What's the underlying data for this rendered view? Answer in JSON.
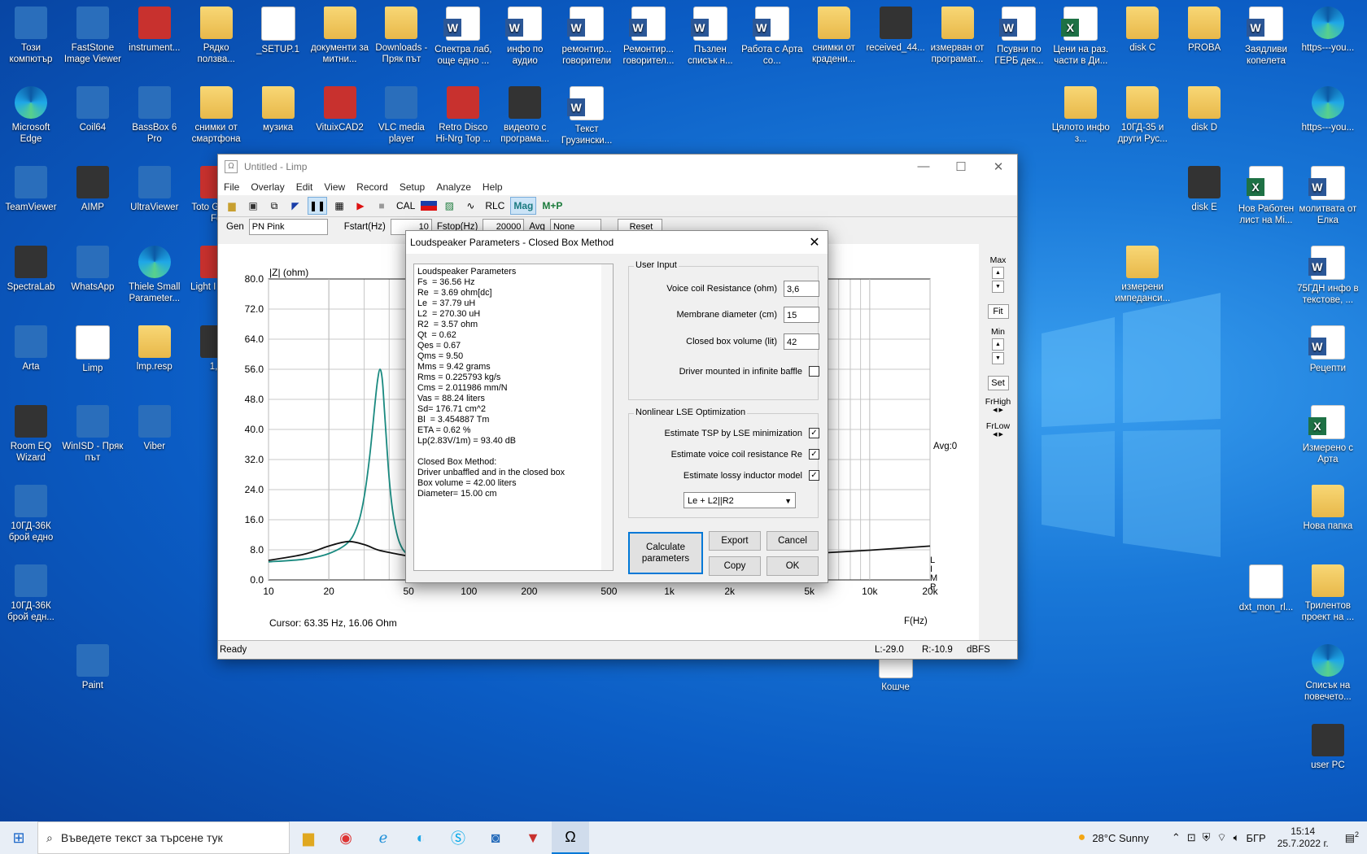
{
  "desktop": {
    "icons": [
      {
        "label": "Този компютър",
        "kind": "app"
      },
      {
        "label": "FastStone Image Viewer",
        "kind": "app"
      },
      {
        "label": "instrument...",
        "kind": "red"
      },
      {
        "label": "Рядко ползва...",
        "kind": "folder"
      },
      {
        "label": "_SETUP.1",
        "kind": "blank"
      },
      {
        "label": "документи за митни...",
        "kind": "folder"
      },
      {
        "label": "Downloads - Пряк път",
        "kind": "folder"
      },
      {
        "label": "Спектра лаб, още едно ...",
        "kind": "word"
      },
      {
        "label": "инфо по аудио",
        "kind": "word"
      },
      {
        "label": "ремонтир... говорители",
        "kind": "word"
      },
      {
        "label": "Ремонтир... говорител...",
        "kind": "word"
      },
      {
        "label": "Пъзлен списък н...",
        "kind": "word"
      },
      {
        "label": "Работа с Арта со...",
        "kind": "word"
      },
      {
        "label": "снимки от крадени...",
        "kind": "folder"
      },
      {
        "label": "received_44...",
        "kind": "dark"
      },
      {
        "label": "измерван от програмат...",
        "kind": "folder"
      },
      {
        "label": "Псувни по ГЕРБ дек...",
        "kind": "word"
      },
      {
        "label": "Цени на раз. части в Ди...",
        "kind": "excel"
      },
      {
        "label": "disk C",
        "kind": "folder"
      },
      {
        "label": "PROBA",
        "kind": "folder"
      },
      {
        "label": "Заядливи копелета",
        "kind": "word"
      },
      {
        "label": "https---you...",
        "kind": "edge"
      },
      {
        "label": "Microsoft Edge",
        "kind": "edge"
      },
      {
        "label": "Coil64",
        "kind": "app"
      },
      {
        "label": "BassBox 6 Pro",
        "kind": "app"
      },
      {
        "label": "снимки от смартфона",
        "kind": "folder"
      },
      {
        "label": "музика",
        "kind": "folder"
      },
      {
        "label": "VituixCAD2",
        "kind": "red"
      },
      {
        "label": "VLC media player",
        "kind": "app"
      },
      {
        "label": "Retro Disco Hi-Nrg Top ...",
        "kind": "red"
      },
      {
        "label": "видеото с програма...",
        "kind": "dark"
      },
      {
        "label": "Текст Грузински...",
        "kind": "word"
      },
      {
        "label": "Цялото инфо з...",
        "kind": "folder"
      },
      {
        "label": "10ГД-35 и други Рус...",
        "kind": "folder"
      },
      {
        "label": "disk D",
        "kind": "folder"
      },
      {
        "label": "https---you...",
        "kind": "edge"
      },
      {
        "label": "TeamViewer",
        "kind": "app"
      },
      {
        "label": "AIMP",
        "kind": "dark"
      },
      {
        "label": "UltraViewer",
        "kind": "app"
      },
      {
        "label": "Toto Gr Hits Fo",
        "kind": "red"
      },
      {
        "label": "disk E",
        "kind": "dark"
      },
      {
        "label": "Нов Работен лист на Mi...",
        "kind": "excel"
      },
      {
        "label": "молитвата от Елка",
        "kind": "word"
      },
      {
        "label": "SpectraLab",
        "kind": "dark"
      },
      {
        "label": "WhatsApp",
        "kind": "app"
      },
      {
        "label": "Thiele Small Parameter...",
        "kind": "edge"
      },
      {
        "label": "Light I Resiz",
        "kind": "red"
      },
      {
        "label": "измерени импеданси...",
        "kind": "folder"
      },
      {
        "label": "75ГДН инфо в текстове, ...",
        "kind": "word"
      },
      {
        "label": "Arta",
        "kind": "app"
      },
      {
        "label": "Limp",
        "kind": "blank"
      },
      {
        "label": "lmp.resp",
        "kind": "folder"
      },
      {
        "label": "1,1",
        "kind": "dark"
      },
      {
        "label": "Рецепти",
        "kind": "word"
      },
      {
        "label": "Room EQ Wizard",
        "kind": "dark"
      },
      {
        "label": "WinISD - Пряк път",
        "kind": "app"
      },
      {
        "label": "Viber",
        "kind": "app"
      },
      {
        "label": "Измерено с Арта",
        "kind": "excel"
      },
      {
        "label": "Нова папка",
        "kind": "folder"
      },
      {
        "label": "10ГД-36К брой едно",
        "kind": "app"
      },
      {
        "label": "10ГД-36К брой едн...",
        "kind": "app"
      },
      {
        "label": "dxt_mon_rl...",
        "kind": "blank"
      },
      {
        "label": "Трилентов проект на ...",
        "kind": "folder"
      },
      {
        "label": "Paint",
        "kind": "app"
      },
      {
        "label": "Кошче",
        "kind": "blank"
      },
      {
        "label": "Списък на повечето...",
        "kind": "edge"
      },
      {
        "label": "user PC",
        "kind": "dark"
      }
    ]
  },
  "window": {
    "title": "Untitled - Limp",
    "app_icon": "Ω",
    "controls": {
      "minimize": "—",
      "maximize": "☐",
      "close": "✕"
    },
    "menu": [
      "File",
      "Overlay",
      "Edit",
      "View",
      "Record",
      "Setup",
      "Analyze",
      "Help"
    ],
    "toolbar": {
      "cal": "CAL",
      "rlc": "RLC",
      "mag": "Mag",
      "mp": "M+P"
    },
    "genbar": {
      "gen_label": "Gen",
      "gen_value": "PN Pink",
      "fstart_label": "Fstart(Hz)",
      "fstart_value": "10",
      "fstop_label": "Fstop(Hz)",
      "fstop_value": "20000",
      "avg_label": "Avg",
      "avg_value": "None",
      "reset_label": "Reset"
    },
    "plot": {
      "ylabel": "|Z| (ohm)",
      "xlabel": "F(Hz)",
      "avg_text": "Avg:0",
      "cursor_text": "Cursor: 63.35 Hz, 16.06 Ohm",
      "watermark": [
        "L",
        "I",
        "M",
        "P"
      ]
    },
    "right_panel": {
      "max": "Max",
      "fit": "Fit",
      "min": "Min",
      "set": "Set",
      "frhigh": "FrHigh",
      "frlow": "FrLow"
    },
    "status": {
      "ready": "Ready",
      "l": "L:-29.0",
      "r": "R:-10.9",
      "unit": "dBFS"
    }
  },
  "chart_data": {
    "type": "line",
    "xlabel": "F(Hz)",
    "ylabel": "|Z| (ohm)",
    "xscale": "log",
    "xlim": [
      10,
      20000
    ],
    "ylim": [
      0,
      80
    ],
    "xticks": [
      10,
      20,
      50,
      100,
      200,
      500,
      1000,
      2000,
      5000,
      10000,
      20000
    ],
    "xtick_labels": [
      "10",
      "20",
      "50",
      "100",
      "200",
      "500",
      "1k",
      "2k",
      "5k",
      "10k",
      "20k"
    ],
    "yticks": [
      0,
      8,
      16,
      24,
      32,
      40,
      48,
      56,
      64,
      72,
      80
    ],
    "ytick_labels": [
      "0.0",
      "8.0",
      "16.0",
      "24.0",
      "32.0",
      "40.0",
      "48.0",
      "56.0",
      "64.0",
      "72.0",
      "80.0"
    ],
    "grid": true,
    "series": [
      {
        "color": "#1a8a80",
        "x": [
          10,
          15,
          20,
          25,
          28,
          30,
          32,
          34,
          35,
          36,
          37,
          38,
          40,
          42,
          45,
          50,
          60,
          80,
          100
        ],
        "y": [
          4.8,
          5.5,
          7.0,
          10,
          15,
          22,
          33,
          47,
          53,
          56,
          53,
          44,
          27,
          17,
          10,
          6.5,
          5.0,
          4.5,
          4.3
        ]
      },
      {
        "color": "#111111",
        "x": [
          10,
          15,
          20,
          25,
          30,
          35,
          40,
          50,
          60,
          80,
          100,
          150,
          200,
          300,
          500,
          1000,
          2000,
          5000,
          10000,
          20000
        ],
        "y": [
          5.2,
          6.8,
          9.0,
          10.2,
          9.4,
          8.0,
          7.3,
          6.3,
          5.5,
          5.0,
          4.9,
          4.8,
          4.8,
          4.9,
          5.1,
          5.4,
          6.0,
          7.0,
          7.9,
          9.0
        ]
      }
    ]
  },
  "dialog": {
    "title": "Loudspeaker Parameters - Closed Box Method",
    "close": "✕",
    "params": [
      "Loudspeaker Parameters",
      "Fs  = 36.56 Hz",
      "Re  = 3.69 ohm[dc]",
      "Le  = 37.79 uH",
      "L2  = 270.30 uH",
      "R2  = 3.57 ohm",
      "Qt  = 0.62",
      "Qes = 0.67",
      "Qms = 9.50",
      "Mms = 9.42 grams",
      "Rms = 0.225793 kg/s",
      "Cms = 2.011986 mm/N",
      "Vas = 88.24 liters",
      "Sd= 176.71 cm^2",
      "Bl  = 3.454887 Tm",
      "ETA = 0.62 %",
      "Lp(2.83V/1m) = 93.40 dB",
      "",
      "Closed Box Method:",
      "Driver unbaffled and in the closed box",
      "Box volume = 42.00 liters",
      "Diameter= 15.00 cm"
    ],
    "user_input": {
      "legend": "User Input",
      "vc_label": "Voice coil Resistance (ohm)",
      "vc_value": "3,6",
      "md_label": "Membrane diameter (cm)",
      "md_value": "15",
      "cb_label": "Closed box volume (lit)",
      "cb_value": "42",
      "inf_label": "Driver mounted in infinite baffle"
    },
    "nonlinear": {
      "legend": "Nonlinear LSE Optimization",
      "tsp_label": "Estimate TSP by LSE minimization",
      "vcr_label": "Estimate voice coil resistance Re",
      "lossy_label": "Estimate lossy inductor model",
      "model_value": "Le + L2||R2"
    },
    "buttons": {
      "calculate": "Calculate parameters",
      "export": "Export",
      "cancel": "Cancel",
      "copy": "Copy",
      "ok": "OK"
    }
  },
  "taskbar": {
    "search_placeholder": "Въведете текст за търсене тук",
    "weather": "28°C  Sunny",
    "lang": "БГР",
    "time": "15:14",
    "date": "25.7.2022 г.",
    "notify": "2"
  }
}
